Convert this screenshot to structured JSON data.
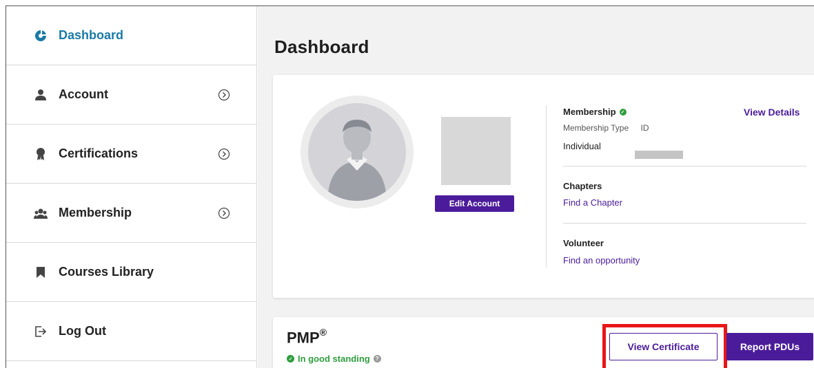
{
  "sidebar": {
    "items": [
      {
        "label": "Dashboard",
        "icon": "dashboard-icon",
        "active": true
      },
      {
        "label": "Account",
        "icon": "user-icon"
      },
      {
        "label": "Certifications",
        "icon": "certification-ribbon-icon"
      },
      {
        "label": "Membership",
        "icon": "group-icon"
      },
      {
        "label": "Courses Library",
        "icon": "bookmark-icon"
      },
      {
        "label": "Log Out",
        "icon": "logout-icon"
      }
    ]
  },
  "main": {
    "title": "Dashboard",
    "profile": {
      "edit_label": "Edit Account",
      "membership_title": "Membership",
      "view_details": "View Details",
      "membership_type_label": "Membership Type",
      "id_label": "ID",
      "membership_type_value": "Individual",
      "chapters_title": "Chapters",
      "chapters_link": "Find a Chapter",
      "volunteer_title": "Volunteer",
      "volunteer_link": "Find an opportunity"
    },
    "certification": {
      "title": "PMP",
      "registered_mark": "®",
      "status": "In good standing",
      "view_certificate": "View Certificate",
      "report_pdus": "Report PDUs"
    }
  },
  "colors": {
    "accent_purple": "#4b1c9a",
    "active_blue": "#1a7aa6",
    "success_green": "#2e9e3e",
    "highlight_red": "#e8161a"
  }
}
